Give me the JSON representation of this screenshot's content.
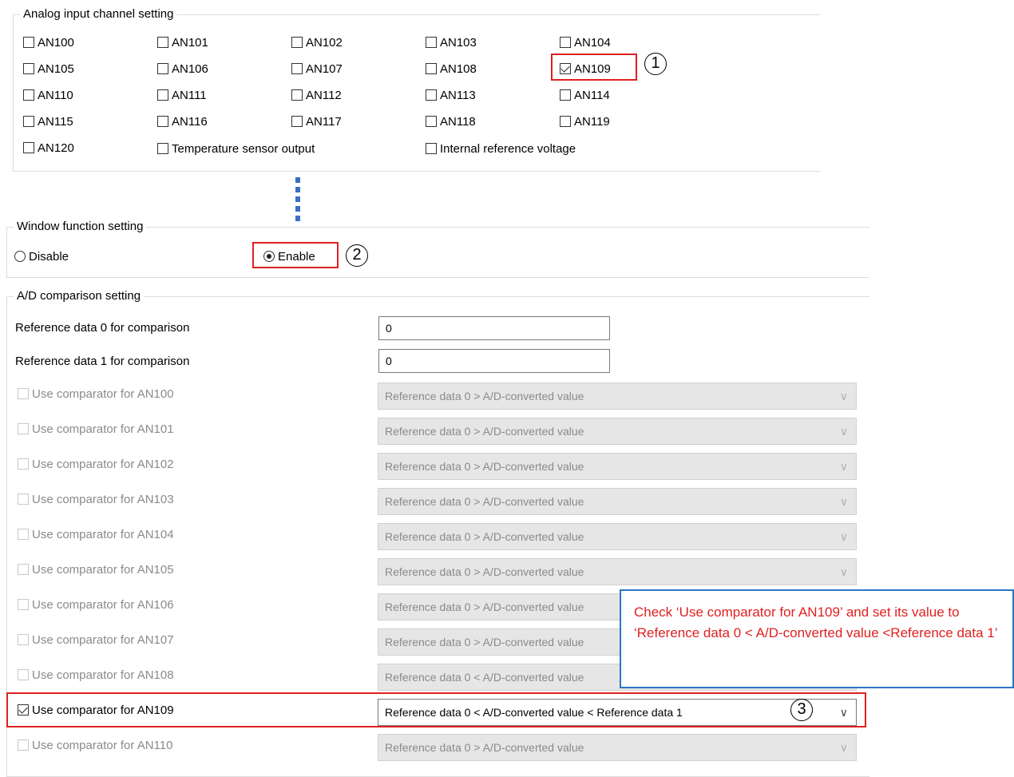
{
  "analog_input": {
    "title": "Analog input channel setting",
    "channels": [
      {
        "label": "AN100",
        "checked": false
      },
      {
        "label": "AN101",
        "checked": false
      },
      {
        "label": "AN102",
        "checked": false
      },
      {
        "label": "AN103",
        "checked": false
      },
      {
        "label": "AN104",
        "checked": false
      },
      {
        "label": "AN105",
        "checked": false
      },
      {
        "label": "AN106",
        "checked": false
      },
      {
        "label": "AN107",
        "checked": false
      },
      {
        "label": "AN108",
        "checked": false
      },
      {
        "label": "AN109",
        "checked": true
      },
      {
        "label": "AN110",
        "checked": false
      },
      {
        "label": "AN111",
        "checked": false
      },
      {
        "label": "AN112",
        "checked": false
      },
      {
        "label": "AN113",
        "checked": false
      },
      {
        "label": "AN114",
        "checked": false
      },
      {
        "label": "AN115",
        "checked": false
      },
      {
        "label": "AN116",
        "checked": false
      },
      {
        "label": "AN117",
        "checked": false
      },
      {
        "label": "AN118",
        "checked": false
      },
      {
        "label": "AN119",
        "checked": false
      },
      {
        "label": "AN120",
        "checked": false
      }
    ],
    "temp_sensor_label": "Temperature sensor output",
    "internal_ref_label": "Internal reference voltage"
  },
  "window_function": {
    "title": "Window function setting",
    "disable_label": "Disable",
    "enable_label": "Enable",
    "selected": "Enable"
  },
  "ad_comparison": {
    "title": "A/D comparison setting",
    "ref0_label": "Reference data 0 for comparison",
    "ref0_value": "0",
    "ref1_label": "Reference data 1 for comparison",
    "ref1_value": "0",
    "comparators": [
      {
        "label": "Use comparator for AN100",
        "checked": false,
        "enabled": false,
        "value": "Reference data 0 > A/D-converted value"
      },
      {
        "label": "Use comparator for AN101",
        "checked": false,
        "enabled": false,
        "value": "Reference data 0 > A/D-converted value"
      },
      {
        "label": "Use comparator for AN102",
        "checked": false,
        "enabled": false,
        "value": "Reference data 0 > A/D-converted value"
      },
      {
        "label": "Use comparator for AN103",
        "checked": false,
        "enabled": false,
        "value": "Reference data 0 > A/D-converted value"
      },
      {
        "label": "Use comparator for AN104",
        "checked": false,
        "enabled": false,
        "value": "Reference data 0 > A/D-converted value"
      },
      {
        "label": "Use comparator for AN105",
        "checked": false,
        "enabled": false,
        "value": "Reference data 0 > A/D-converted value"
      },
      {
        "label": "Use comparator for AN106",
        "checked": false,
        "enabled": false,
        "value": "Reference data 0 > A/D-converted value"
      },
      {
        "label": "Use comparator for AN107",
        "checked": false,
        "enabled": false,
        "value": "Reference data 0 > A/D-converted value"
      },
      {
        "label": "Use comparator for AN108",
        "checked": false,
        "enabled": false,
        "value": "Reference data 0 < A/D-converted value"
      },
      {
        "label": "Use comparator for AN109",
        "checked": true,
        "enabled": true,
        "value": "Reference data 0 < A/D-converted value < Reference data 1"
      },
      {
        "label": "Use comparator for AN110",
        "checked": false,
        "enabled": false,
        "value": "Reference data 0 > A/D-converted value"
      }
    ]
  },
  "annotations": {
    "step1": "1",
    "step2": "2",
    "step3": "3",
    "note": "Check ‘Use comparator for AN109’ and set its value to ‘Reference data 0 < A/D-converted value <Reference data 1’"
  },
  "colors": {
    "highlight": "#e02020",
    "note_border": "#2a77c4",
    "dots": "#3b6fc4"
  },
  "icons": {
    "dropdown": "chevron-down-icon"
  }
}
